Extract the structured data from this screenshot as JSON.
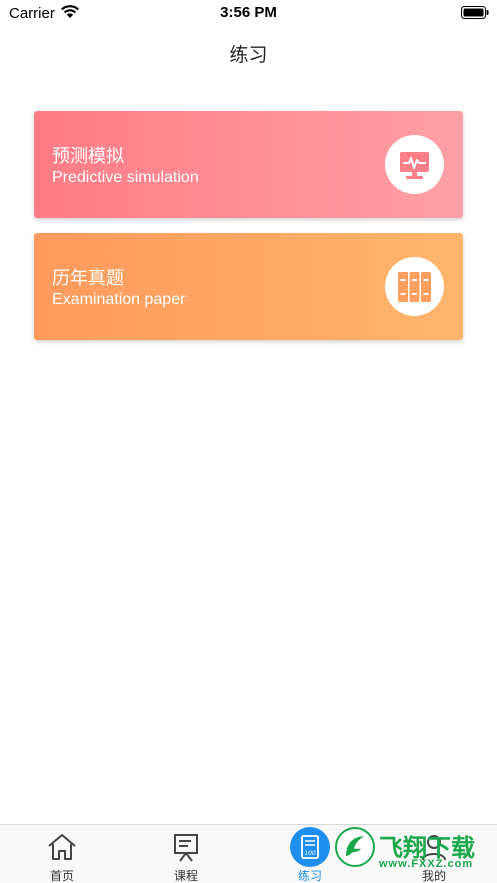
{
  "status_bar": {
    "carrier": "Carrier",
    "time": "3:56 PM"
  },
  "header": {
    "title": "练习"
  },
  "cards": [
    {
      "title": "预测模拟",
      "subtitle": "Predictive simulation",
      "icon": "monitor-pulse-icon",
      "gradient": [
        "#ff7b85",
        "#ffa0a6"
      ]
    },
    {
      "title": "历年真题",
      "subtitle": "Examination paper",
      "icon": "books-icon",
      "gradient": [
        "#ff9a5c",
        "#ffb56c"
      ]
    }
  ],
  "tab_bar": {
    "active_color": "#1e8ef0",
    "tabs": [
      {
        "label": "首页",
        "icon": "home-icon",
        "active": false
      },
      {
        "label": "课程",
        "icon": "presentation-board-icon",
        "active": false
      },
      {
        "label": "练习",
        "icon": "exam-paper-icon",
        "active": true
      },
      {
        "label": "我的",
        "icon": "profile-icon",
        "active": false
      }
    ]
  },
  "watermark": {
    "text": "飞翔下载",
    "url": "www.FXXZ.com"
  }
}
